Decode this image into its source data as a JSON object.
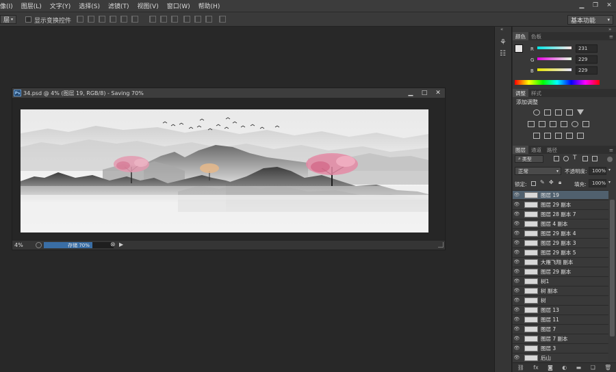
{
  "menubar": {
    "items": [
      "像(I)",
      "图层(L)",
      "文字(Y)",
      "选择(S)",
      "滤镜(T)",
      "视图(V)",
      "窗口(W)",
      "帮助(H)"
    ]
  },
  "options_bar": {
    "mode_value": "层",
    "show_transform_label": "显示变换控件",
    "workspace": "基本功能"
  },
  "document": {
    "title": "34.psd @ 4% (图层 19, RGB/8) - Saving 70%",
    "zoom": "4%",
    "progress_label": "存储 70%",
    "progress_fraction": 0.7
  },
  "color_panel": {
    "tabs": [
      "颜色",
      "色板"
    ],
    "channels": [
      {
        "label": "R",
        "value": "231"
      },
      {
        "label": "G",
        "value": "229"
      },
      {
        "label": "B",
        "value": "229"
      }
    ]
  },
  "adjustments_panel": {
    "tabs": [
      "调整",
      "样式"
    ],
    "title": "添加调整"
  },
  "layers_panel": {
    "tabs": [
      "图层",
      "通道",
      "路径"
    ],
    "filter_kind": "类型",
    "blend_mode": "正常",
    "opacity_label": "不透明度:",
    "opacity_value": "100%",
    "lock_label": "锁定:",
    "fill_label": "填充:",
    "fill_value": "100%",
    "layers": [
      "图层 19",
      "图层 29 副本",
      "图层 28 副本 7",
      "图层 4 副本",
      "图层 29 副本 4",
      "图层 29 副本 3",
      "图层 29 副本 5",
      "大雁飞翔 副本",
      "图层 29 副本",
      "树1",
      "树 副本",
      "树",
      "图层 13",
      "图层 11",
      "图层 7",
      "图层 7 副本",
      "图层 3",
      "后山"
    ],
    "selected_index": 0
  },
  "colors": {
    "accent": "#3a6ea5",
    "panel_bg": "#383838",
    "app_bg": "#282828"
  }
}
